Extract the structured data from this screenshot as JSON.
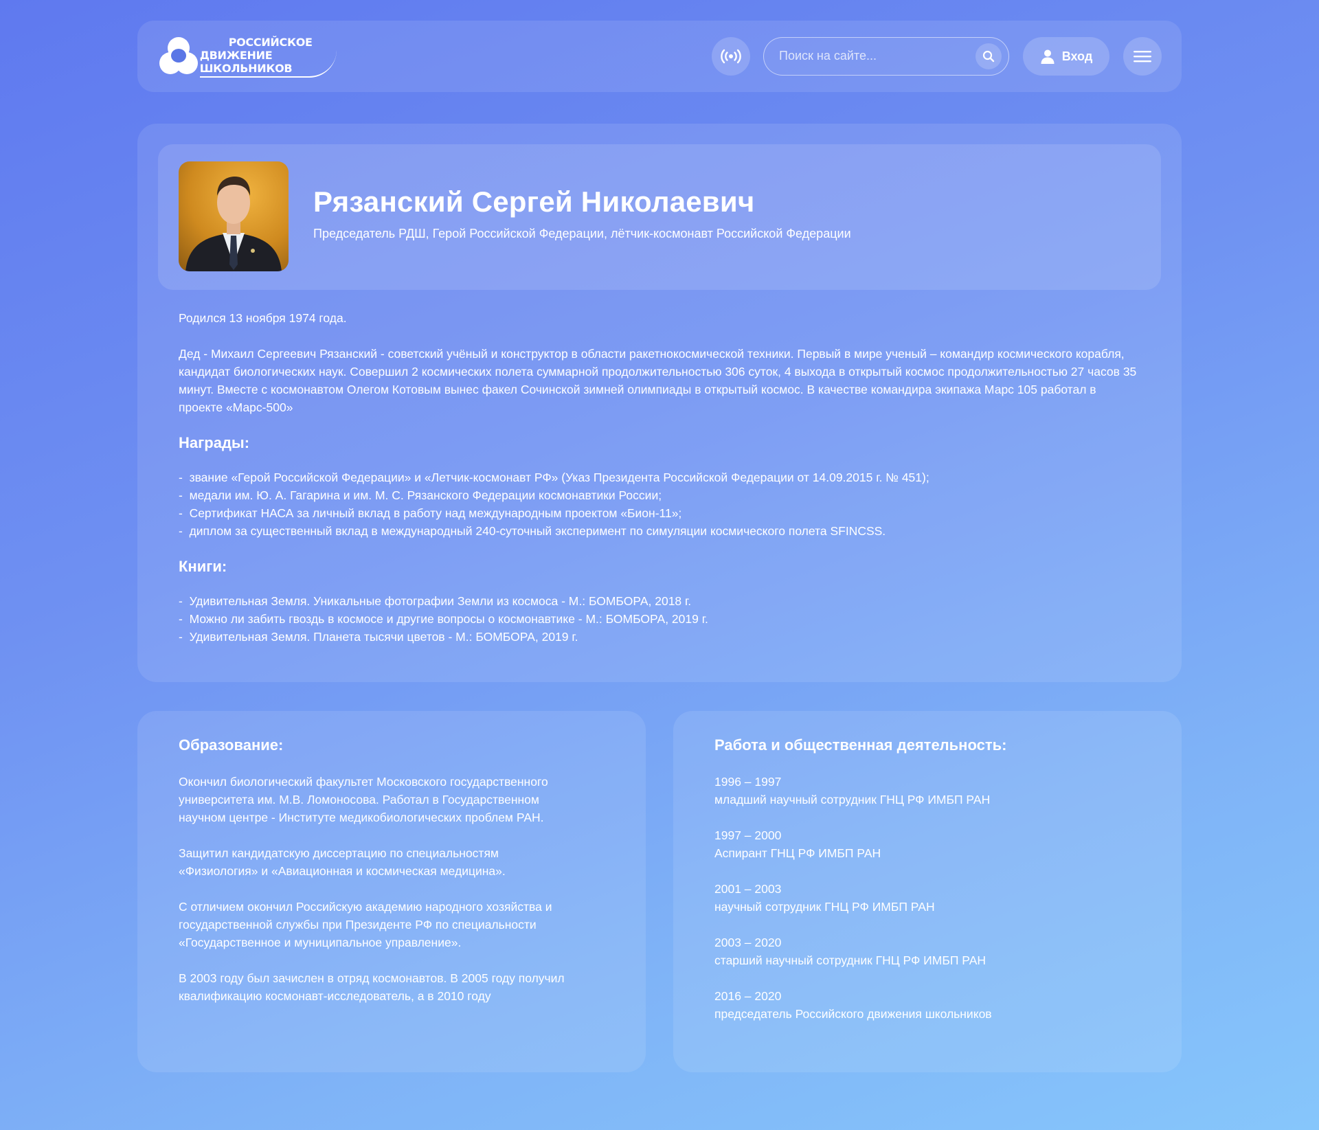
{
  "header": {
    "logo_line1": "Российское",
    "logo_line2": "движение школьников",
    "search_placeholder": "Поиск на сайте...",
    "login_label": "Вход",
    "icons": {
      "radio": "broadcast-icon",
      "search": "search-icon",
      "user": "user-icon",
      "menu": "hamburger-menu-icon"
    }
  },
  "profile": {
    "name": "Рязанский Сергей Николаевич",
    "subtitle": "Председатель РДШ, Герой Российской Федерации, лётчик-космонавт Российской Федерации"
  },
  "bio": {
    "born": "Родился 13 ноября 1974 года.",
    "description": "Дед - Михаил Сергеевич Рязанский - советский учёный и конструктор в области ракетнокосмической техники. Первый в мире ученый – командир космического корабля, кандидат биологических наук. Совершил 2 космических полета суммарной продолжительностью 306 суток, 4 выхода в открытый космос продолжительностью 27 часов 35 минут. Вместе с космонавтом Олегом Котовым вынес факел Сочинской зимней олимпиады в открытый космос. В качестве командира экипажа Марс 105 работал в проекте «Марс-500»",
    "awards_title": "Награды:",
    "awards": [
      "звание «Герой Российской Федерации» и «Летчик-космонавт РФ» (Указ Президента Российской Федерации от 14.09.2015 г. № 451);",
      "медали им. Ю. А. Гагарина и им. М. С. Рязанского Федерации космонавтики России;",
      "Сертификат НАСА за личный вклад в работу над международным проектом «Бион-11»;",
      "диплом за существенный вклад в международный 240-суточный эксперимент по симуляции космического полета SFINCSS."
    ],
    "books_title": "Книги:",
    "books": [
      "Удивительная Земля. Уникальные фотографии Земли из космоса - М.: БОМБОРА, 2018 г.",
      "Можно ли забить гвоздь в космосе и другие вопросы о космонавтике - М.: БОМБОРА, 2019 г.",
      "Удивительная Земля. Планета тысячи цветов - М.: БОМБОРА, 2019 г."
    ]
  },
  "education": {
    "title": "Образование:",
    "paragraphs": [
      "Окончил биологический факультет Московского государственного университета им. М.В. Ломоносова. Работал в Государственном научном центре - Институте медикобиологических проблем РАН.",
      "Защитил кандидатскую диссертацию по специальностям «Физиология» и «Авиационная и космическая медицина».",
      "С отличием окончил Российскую академию народного хозяйства и государственной службы при Президенте РФ по специальности «Государственное и муниципальное управление».",
      "В 2003 году был зачислен в отряд космонавтов. В 2005 году получил квалификацию космонавт-исследователь, а в 2010 году"
    ]
  },
  "work": {
    "title": "Работа и общественная деятельность:",
    "items": [
      {
        "years": "1996 – 1997",
        "role": "младший научный сотрудник ГНЦ РФ ИМБП РАН"
      },
      {
        "years": "1997 – 2000",
        "role": "Аспирант ГНЦ РФ ИМБП РАН"
      },
      {
        "years": "2001 – 2003",
        "role": "научный сотрудник ГНЦ РФ ИМБП РАН"
      },
      {
        "years": "2003 – 2020",
        "role": "старший научный сотрудник ГНЦ РФ ИМБП РАН"
      },
      {
        "years": "2016 – 2020",
        "role": "председатель Российского движения школьников"
      }
    ]
  },
  "colors": {
    "bg_start": "#5f79ef",
    "bg_end": "#86c6fb",
    "text": "#ffffff"
  }
}
